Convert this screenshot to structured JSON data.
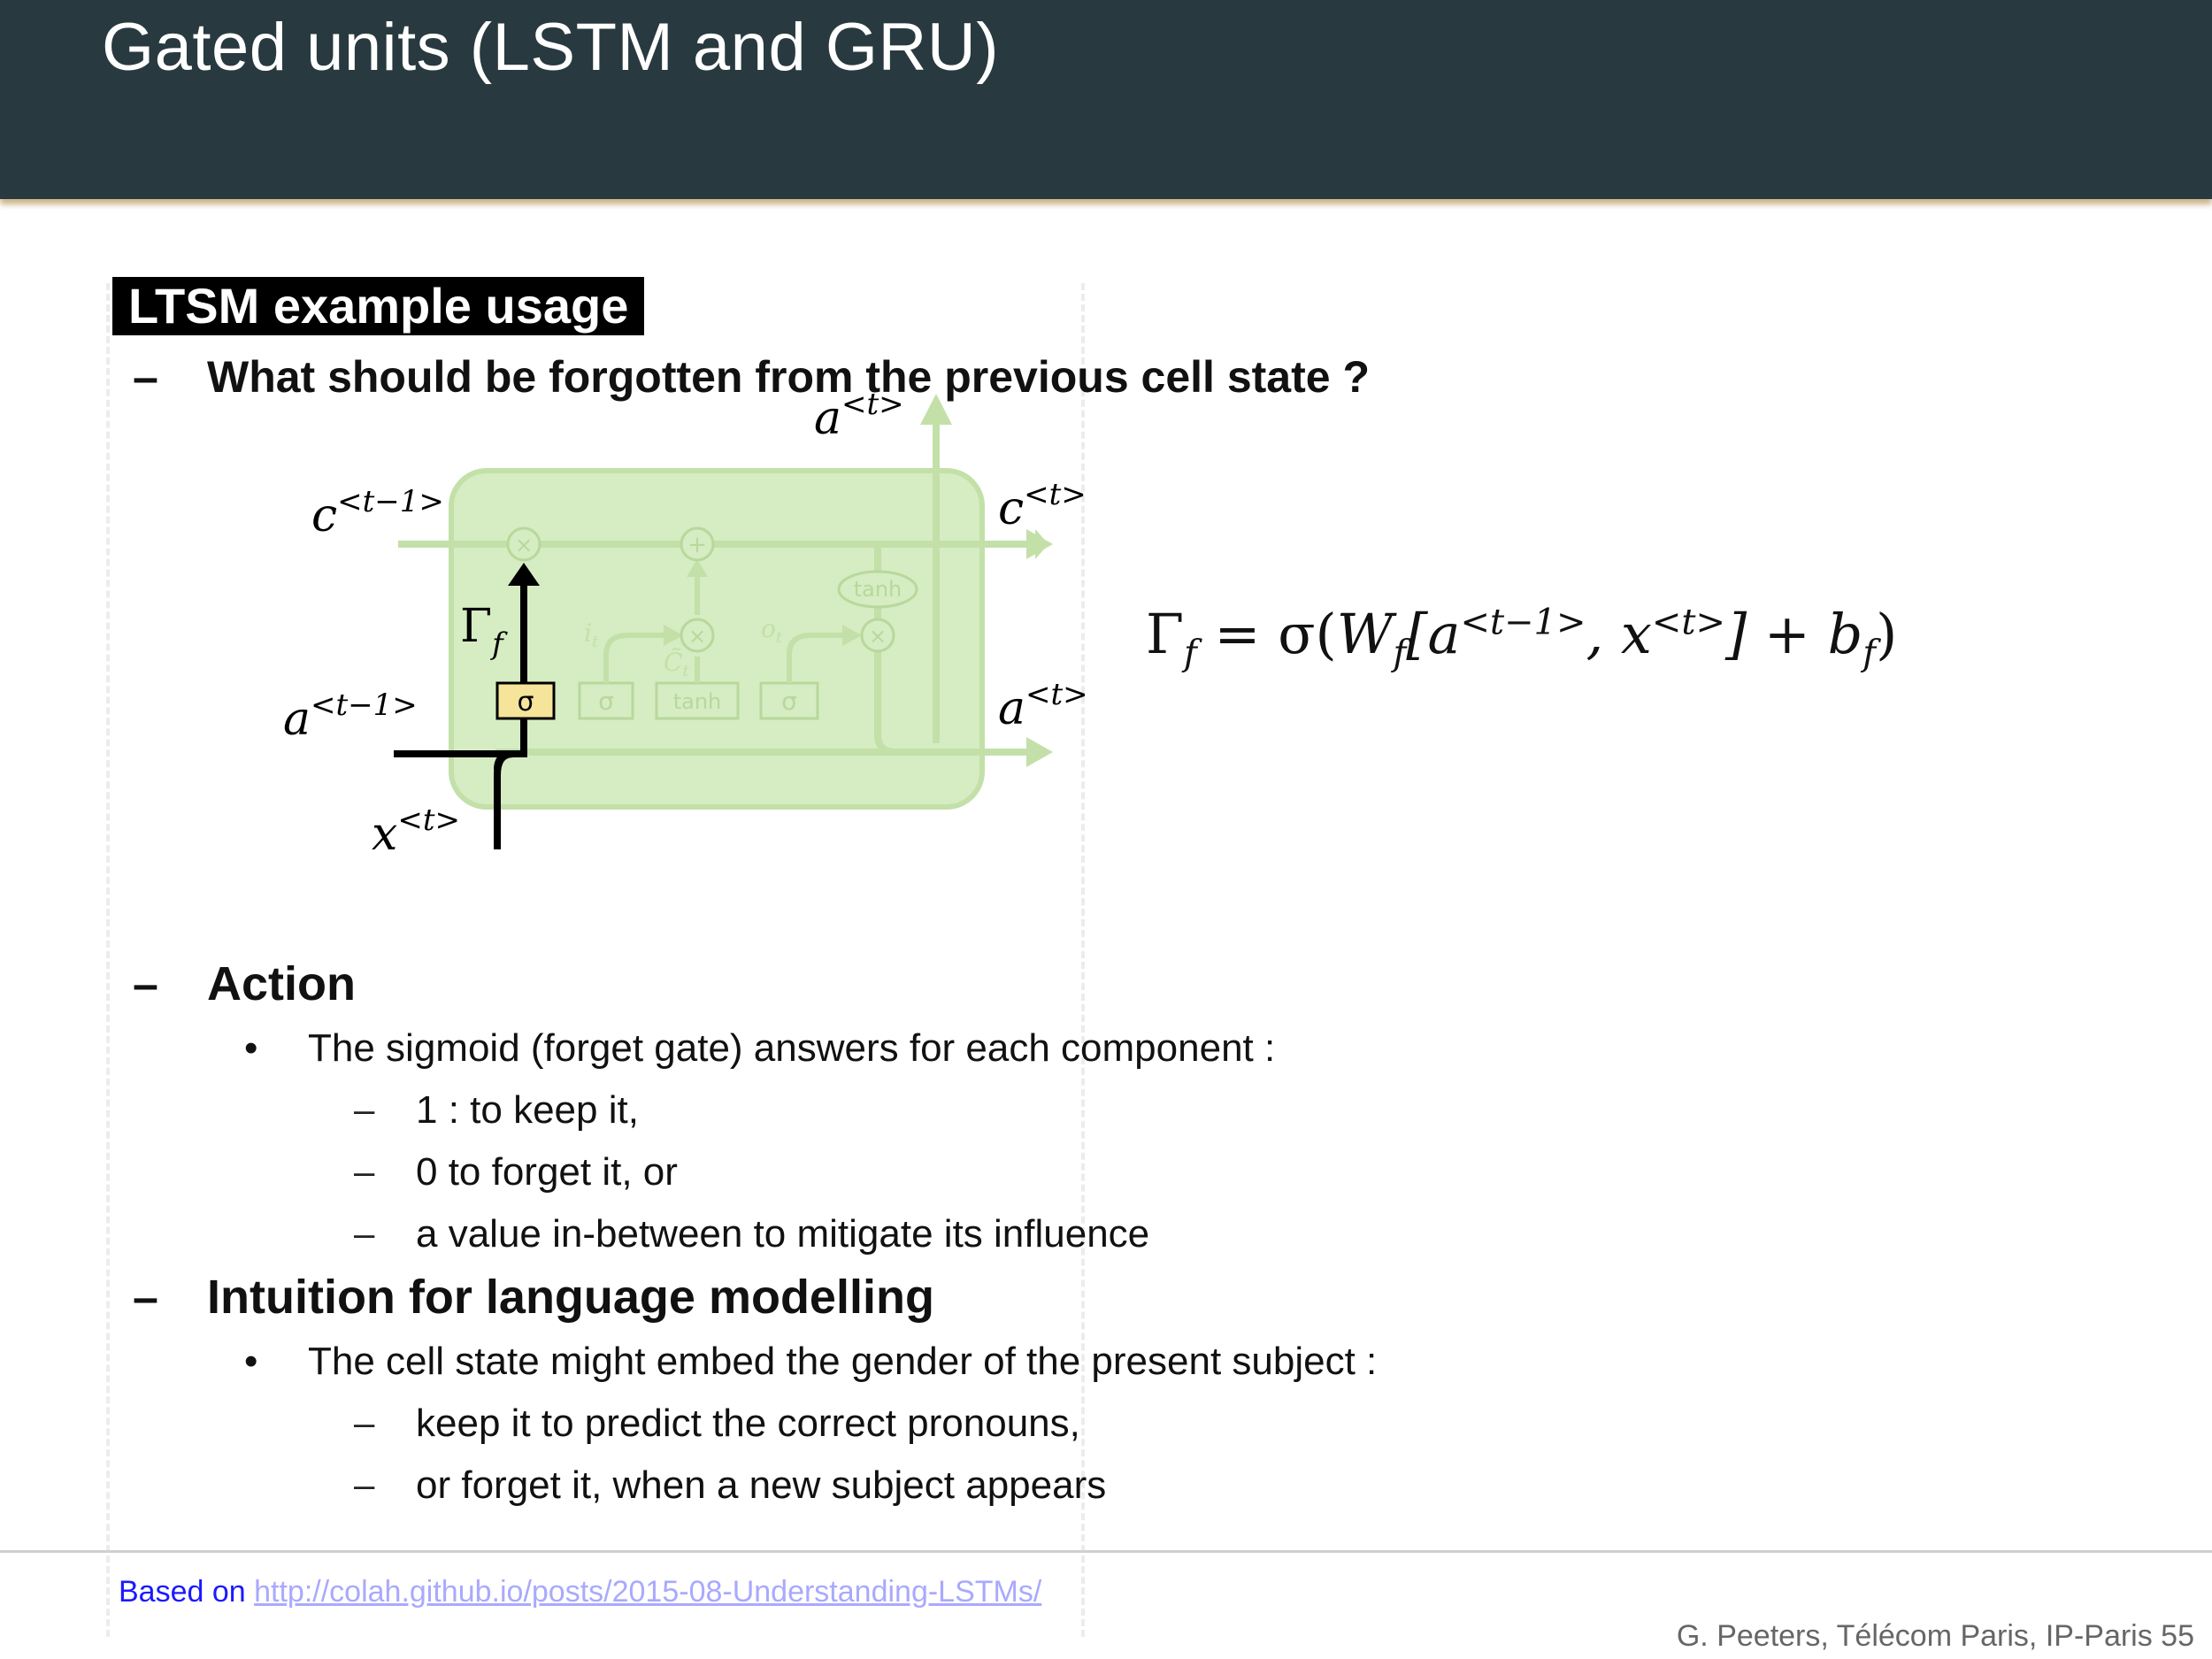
{
  "header": {
    "title": "Gated units (LSTM and GRU)"
  },
  "section": {
    "label": "LTSM example usage"
  },
  "question": {
    "dash": "–",
    "text": "What should be forgotten from the previous cell state ?"
  },
  "diagram": {
    "a_top": "a",
    "a_top_sup": "<t>",
    "c_prev": "c",
    "c_prev_sup": "<t−1>",
    "c_next": "c",
    "c_next_sup": "<t>",
    "a_prev": "a",
    "a_prev_sup": "<t−1>",
    "a_next": "a",
    "a_next_sup": "<t>",
    "x_in": "x",
    "x_in_sup": "<t>",
    "gamma": "Γ",
    "gamma_sub": "f",
    "sigma_label": "σ",
    "tanh_label": "tanh",
    "times_label": "×",
    "plus_label": "+",
    "i_label": "i",
    "i_sub": "t",
    "o_label": "o",
    "o_sub": "t",
    "c_tilde": "C̃",
    "c_tilde_sub": "t",
    "colors": {
      "cell": "#d6ecc2",
      "gate_highlight": "#f5e49a",
      "active_path": "#000000"
    }
  },
  "formula": {
    "lhs": "Γ",
    "lhs_sub": "f",
    "eq": " = σ(",
    "w": "W",
    "w_sub": "f",
    "open": "[a",
    "a_sup": "<t−1>",
    "comma": ", x",
    "x_sup": "<t>",
    "close": "] + b",
    "b_sub": "f",
    "end": ")"
  },
  "action": {
    "dash": "–",
    "heading": "Action",
    "bullet": "•",
    "text": "The sigmoid (forget gate) answers for each component :",
    "items": [
      "1 : to keep it,",
      "0 to forget it, or",
      "a value in-between to mitigate its influence"
    ],
    "item_dash": "–"
  },
  "intuition": {
    "dash": "–",
    "heading": "Intuition for language modelling",
    "bullet": "•",
    "text": "The cell state might embed the gender of the present subject :",
    "items": [
      "keep it to predict the correct pronouns,",
      "or forget it, when a new subject appears"
    ],
    "item_dash": "–"
  },
  "source": {
    "prefix": "Based on ",
    "url": "http://colah.github.io/posts/2015-08-Understanding-LSTMs/"
  },
  "footer": {
    "text": "G. Peeters, Télécom Paris, IP-Paris   55"
  }
}
